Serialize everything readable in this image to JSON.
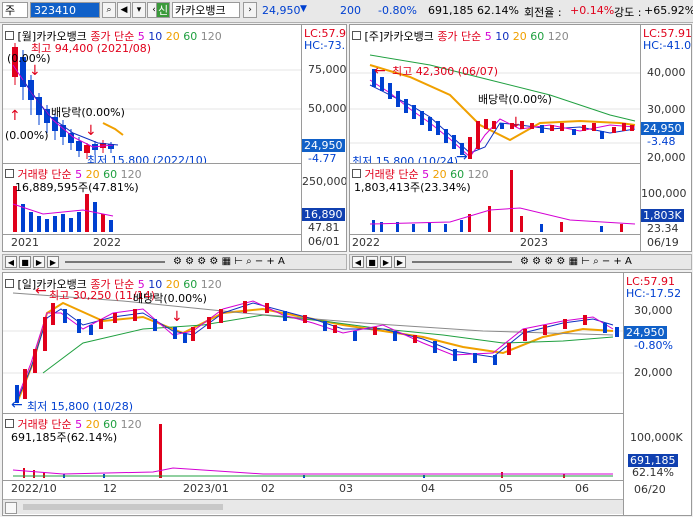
{
  "toolbar": {
    "market_label": "주",
    "stock_code": "323410",
    "new_badge": "신",
    "stock_name": "카카오뱅크",
    "price": "24,950",
    "change": "200",
    "change_pct": "-0.80%",
    "volume": "691,185",
    "volume_ratio": "62.14%",
    "turnover_label": "회전율 :",
    "turnover_value": "+0.14%",
    "strength_label": "강도 :",
    "strength_value": "+65.92%"
  },
  "panels": {
    "weekly": {
      "title": "[월]카카오뱅크",
      "ma_label": "종가 단순",
      "ma_periods": [
        "5",
        "10",
        "20",
        "60",
        "120"
      ],
      "high_note": "최고 94,400 (2021/08)",
      "low_note": "최저 15,800 (2022/10)",
      "dividend_note": "배당락(0.00%)",
      "pct_note_1": "(0.00%)",
      "pct_note_2": "(0.00%)",
      "lc": "LC:57.91",
      "hc": "HC:-73.5",
      "y_ticks": [
        "75,000",
        "50,000"
      ],
      "price_box": "24,950",
      "price_pct": "-4.77",
      "vol_label": "거래량 단순",
      "vol_periods": [
        "5",
        "20",
        "60",
        "120"
      ],
      "vol_value": "16,889,595주(47.81%)",
      "vol_ticks": [
        "250,000"
      ],
      "vol_box": "16,890",
      "vol_pct": "47.81",
      "x_ticks": [
        "2021",
        "2022"
      ],
      "x_end": "06/01"
    },
    "weekly2": {
      "title": "[주]카카오뱅크",
      "ma_label": "종가 단순",
      "ma_periods": [
        "5",
        "10",
        "20",
        "60",
        "120"
      ],
      "high_note": "최고 42,300 (06/07)",
      "low_note": "최저 15,800 (10/24)",
      "dividend_note": "배당락(0.00%)",
      "lc": "LC:57.91",
      "hc": "HC:-41.0",
      "y_ticks": [
        "40,000",
        "30,000",
        "20,000"
      ],
      "price_box": "24,950",
      "price_pct": "-3.48",
      "vol_label": "거래량 단순",
      "vol_periods": [
        "5",
        "20",
        "60",
        "120"
      ],
      "vol_value": "1,803,413주(23.34%)",
      "vol_ticks": [
        "100,000",
        "50,000"
      ],
      "vol_box": "1,803K",
      "vol_pct": "23.34",
      "x_ticks": [
        "2022",
        "2023"
      ],
      "x_end": "06/19"
    },
    "daily": {
      "title": "[일]카카오뱅크",
      "ma_label": "종가 단순",
      "ma_periods": [
        "5",
        "10",
        "20",
        "60",
        "120"
      ],
      "high_note": "최고 30,250 (11/14)",
      "low_note": "최저 15,800 (10/28)",
      "dividend_note": "배당락(0.00%)",
      "lc": "LC:57.91",
      "hc": "HC:-17.52",
      "y_ticks": [
        "30,000",
        "20,000"
      ],
      "price_box": "24,950",
      "price_pct": "-0.80%",
      "vol_label": "거래량 단순",
      "vol_periods": [
        "5",
        "20",
        "60",
        "120"
      ],
      "vol_value": "691,185주(62.14%)",
      "vol_ticks": [
        "100,000K",
        "50,000"
      ],
      "vol_box": "691,185",
      "vol_pct": "62.14%",
      "x_ticks": [
        "2022/10",
        "12",
        "2023/01",
        "02",
        "03",
        "04",
        "05",
        "06"
      ],
      "x_end": "06/20"
    }
  },
  "colors": {
    "up": "#e0001b",
    "down": "#0040d0",
    "ma5": "#d400d4",
    "ma10": "#1030c0",
    "ma20": "#f0a000",
    "ma60": "#20a040",
    "ma120": "#8a8a8a"
  }
}
